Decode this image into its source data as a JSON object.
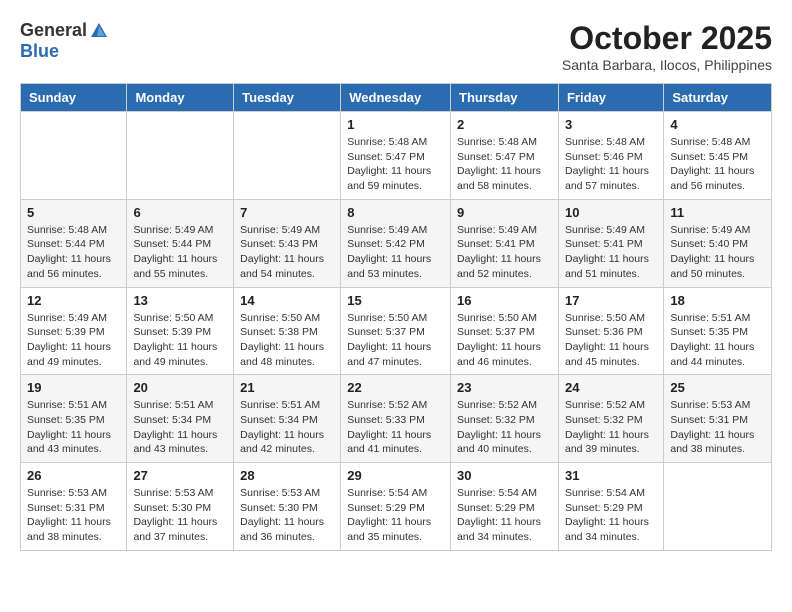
{
  "logo": {
    "general": "General",
    "blue": "Blue"
  },
  "title": {
    "month": "October 2025",
    "location": "Santa Barbara, Ilocos, Philippines"
  },
  "headers": [
    "Sunday",
    "Monday",
    "Tuesday",
    "Wednesday",
    "Thursday",
    "Friday",
    "Saturday"
  ],
  "weeks": [
    [
      {
        "day": "",
        "info": ""
      },
      {
        "day": "",
        "info": ""
      },
      {
        "day": "",
        "info": ""
      },
      {
        "day": "1",
        "info": "Sunrise: 5:48 AM\nSunset: 5:47 PM\nDaylight: 11 hours\nand 59 minutes."
      },
      {
        "day": "2",
        "info": "Sunrise: 5:48 AM\nSunset: 5:47 PM\nDaylight: 11 hours\nand 58 minutes."
      },
      {
        "day": "3",
        "info": "Sunrise: 5:48 AM\nSunset: 5:46 PM\nDaylight: 11 hours\nand 57 minutes."
      },
      {
        "day": "4",
        "info": "Sunrise: 5:48 AM\nSunset: 5:45 PM\nDaylight: 11 hours\nand 56 minutes."
      }
    ],
    [
      {
        "day": "5",
        "info": "Sunrise: 5:48 AM\nSunset: 5:44 PM\nDaylight: 11 hours\nand 56 minutes."
      },
      {
        "day": "6",
        "info": "Sunrise: 5:49 AM\nSunset: 5:44 PM\nDaylight: 11 hours\nand 55 minutes."
      },
      {
        "day": "7",
        "info": "Sunrise: 5:49 AM\nSunset: 5:43 PM\nDaylight: 11 hours\nand 54 minutes."
      },
      {
        "day": "8",
        "info": "Sunrise: 5:49 AM\nSunset: 5:42 PM\nDaylight: 11 hours\nand 53 minutes."
      },
      {
        "day": "9",
        "info": "Sunrise: 5:49 AM\nSunset: 5:41 PM\nDaylight: 11 hours\nand 52 minutes."
      },
      {
        "day": "10",
        "info": "Sunrise: 5:49 AM\nSunset: 5:41 PM\nDaylight: 11 hours\nand 51 minutes."
      },
      {
        "day": "11",
        "info": "Sunrise: 5:49 AM\nSunset: 5:40 PM\nDaylight: 11 hours\nand 50 minutes."
      }
    ],
    [
      {
        "day": "12",
        "info": "Sunrise: 5:49 AM\nSunset: 5:39 PM\nDaylight: 11 hours\nand 49 minutes."
      },
      {
        "day": "13",
        "info": "Sunrise: 5:50 AM\nSunset: 5:39 PM\nDaylight: 11 hours\nand 49 minutes."
      },
      {
        "day": "14",
        "info": "Sunrise: 5:50 AM\nSunset: 5:38 PM\nDaylight: 11 hours\nand 48 minutes."
      },
      {
        "day": "15",
        "info": "Sunrise: 5:50 AM\nSunset: 5:37 PM\nDaylight: 11 hours\nand 47 minutes."
      },
      {
        "day": "16",
        "info": "Sunrise: 5:50 AM\nSunset: 5:37 PM\nDaylight: 11 hours\nand 46 minutes."
      },
      {
        "day": "17",
        "info": "Sunrise: 5:50 AM\nSunset: 5:36 PM\nDaylight: 11 hours\nand 45 minutes."
      },
      {
        "day": "18",
        "info": "Sunrise: 5:51 AM\nSunset: 5:35 PM\nDaylight: 11 hours\nand 44 minutes."
      }
    ],
    [
      {
        "day": "19",
        "info": "Sunrise: 5:51 AM\nSunset: 5:35 PM\nDaylight: 11 hours\nand 43 minutes."
      },
      {
        "day": "20",
        "info": "Sunrise: 5:51 AM\nSunset: 5:34 PM\nDaylight: 11 hours\nand 43 minutes."
      },
      {
        "day": "21",
        "info": "Sunrise: 5:51 AM\nSunset: 5:34 PM\nDaylight: 11 hours\nand 42 minutes."
      },
      {
        "day": "22",
        "info": "Sunrise: 5:52 AM\nSunset: 5:33 PM\nDaylight: 11 hours\nand 41 minutes."
      },
      {
        "day": "23",
        "info": "Sunrise: 5:52 AM\nSunset: 5:32 PM\nDaylight: 11 hours\nand 40 minutes."
      },
      {
        "day": "24",
        "info": "Sunrise: 5:52 AM\nSunset: 5:32 PM\nDaylight: 11 hours\nand 39 minutes."
      },
      {
        "day": "25",
        "info": "Sunrise: 5:53 AM\nSunset: 5:31 PM\nDaylight: 11 hours\nand 38 minutes."
      }
    ],
    [
      {
        "day": "26",
        "info": "Sunrise: 5:53 AM\nSunset: 5:31 PM\nDaylight: 11 hours\nand 38 minutes."
      },
      {
        "day": "27",
        "info": "Sunrise: 5:53 AM\nSunset: 5:30 PM\nDaylight: 11 hours\nand 37 minutes."
      },
      {
        "day": "28",
        "info": "Sunrise: 5:53 AM\nSunset: 5:30 PM\nDaylight: 11 hours\nand 36 minutes."
      },
      {
        "day": "29",
        "info": "Sunrise: 5:54 AM\nSunset: 5:29 PM\nDaylight: 11 hours\nand 35 minutes."
      },
      {
        "day": "30",
        "info": "Sunrise: 5:54 AM\nSunset: 5:29 PM\nDaylight: 11 hours\nand 34 minutes."
      },
      {
        "day": "31",
        "info": "Sunrise: 5:54 AM\nSunset: 5:29 PM\nDaylight: 11 hours\nand 34 minutes."
      },
      {
        "day": "",
        "info": ""
      }
    ]
  ]
}
